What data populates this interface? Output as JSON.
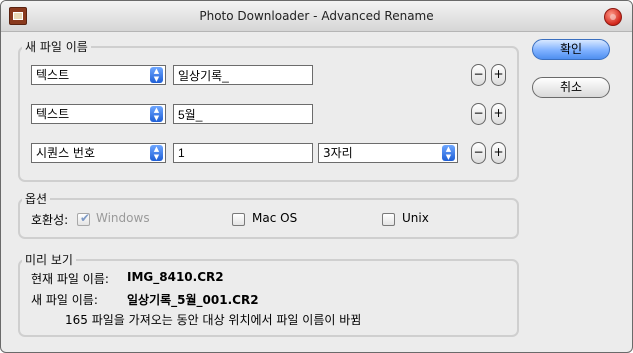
{
  "window": {
    "title": "Photo Downloader - Advanced Rename"
  },
  "new_name_group": {
    "legend": "새 파일 이름",
    "rows": [
      {
        "type_select": "텍스트",
        "value": "일상기록_"
      },
      {
        "type_select": "텍스트",
        "value": "5월_"
      },
      {
        "type_select": "시퀀스 번호",
        "value": "1",
        "digits_select": "3자리"
      }
    ],
    "minus_label": "−",
    "plus_label": "+"
  },
  "buttons": {
    "ok": "확인",
    "cancel": "취소"
  },
  "options_group": {
    "legend": "옵션",
    "compat_label": "호환성:",
    "checkboxes": [
      {
        "label": "Windows",
        "checked": true,
        "disabled": true
      },
      {
        "label": "Mac OS",
        "checked": false,
        "disabled": false
      },
      {
        "label": "Unix",
        "checked": false,
        "disabled": false
      }
    ]
  },
  "preview_group": {
    "legend": "미리 보기",
    "current_label": "현재 파일 이름:",
    "current_value": "IMG_8410.CR2",
    "new_label": "새 파일 이름:",
    "new_value": "일상기록_5월_001.CR2",
    "note": "165 파일을 가져오는 동안 대상 위치에서 파일 이름이 바뀜"
  }
}
